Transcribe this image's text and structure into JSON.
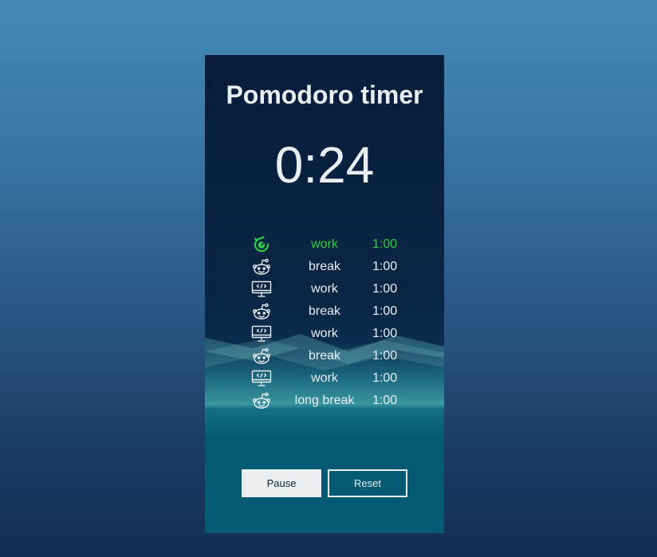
{
  "app": {
    "title": "Pomodoro timer",
    "remaining": "0:24"
  },
  "schedule": [
    {
      "icon": "stopwatch-icon",
      "label": "work",
      "duration": "1:00",
      "active": true
    },
    {
      "icon": "reddit-icon",
      "label": "break",
      "duration": "1:00",
      "active": false
    },
    {
      "icon": "monitor-code-icon",
      "label": "work",
      "duration": "1:00",
      "active": false
    },
    {
      "icon": "reddit-icon",
      "label": "break",
      "duration": "1:00",
      "active": false
    },
    {
      "icon": "monitor-code-icon",
      "label": "work",
      "duration": "1:00",
      "active": false
    },
    {
      "icon": "reddit-icon",
      "label": "break",
      "duration": "1:00",
      "active": false
    },
    {
      "icon": "monitor-code-icon",
      "label": "work",
      "duration": "1:00",
      "active": false
    },
    {
      "icon": "reddit-icon",
      "label": "long break",
      "duration": "1:00",
      "active": false
    }
  ],
  "controls": {
    "pause_label": "Pause",
    "reset_label": "Reset"
  },
  "colors": {
    "active": "#2ecc40",
    "text": "#e8eef2",
    "panel_top": "#071d3a",
    "panel_bottom": "#055a73",
    "background_top": "#4589b8",
    "background_bottom": "#142e52"
  }
}
